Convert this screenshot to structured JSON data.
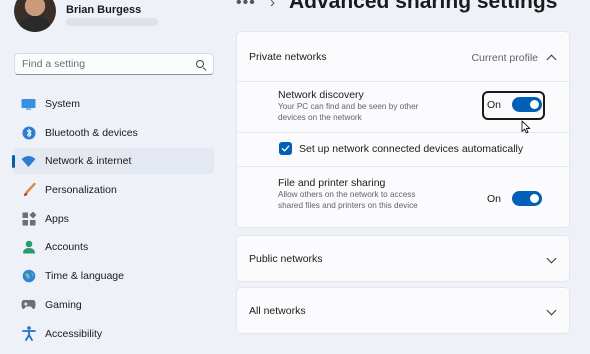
{
  "user": {
    "name": "Brian Burgess"
  },
  "search": {
    "placeholder": "Find a setting"
  },
  "sidebar": {
    "items": [
      {
        "label": "System",
        "icon": "system-icon"
      },
      {
        "label": "Bluetooth & devices",
        "icon": "bluetooth-icon"
      },
      {
        "label": "Network & internet",
        "icon": "wifi-icon",
        "active": true
      },
      {
        "label": "Personalization",
        "icon": "brush-icon"
      },
      {
        "label": "Apps",
        "icon": "apps-icon"
      },
      {
        "label": "Accounts",
        "icon": "accounts-icon"
      },
      {
        "label": "Time & language",
        "icon": "globe-icon"
      },
      {
        "label": "Gaming",
        "icon": "gamepad-icon"
      },
      {
        "label": "Accessibility",
        "icon": "accessibility-icon"
      }
    ]
  },
  "header": {
    "breadcrumb_more": "•••",
    "separator": "›",
    "title": "Advanced sharing settings"
  },
  "private": {
    "title": "Private networks",
    "status": "Current profile",
    "network_discovery": {
      "title": "Network discovery",
      "description": "Your PC can find and be seen by other devices on the network",
      "state": "On",
      "enabled": true
    },
    "auto_setup": {
      "label": "Set up network connected devices automatically",
      "checked": true
    },
    "file_sharing": {
      "title": "File and printer sharing",
      "description": "Allow others on the network to access shared files and printers on this device",
      "state": "On",
      "enabled": true
    }
  },
  "public": {
    "title": "Public networks"
  },
  "all": {
    "title": "All networks"
  },
  "colors": {
    "accent": "#005fb8",
    "background": "#eef1f8",
    "card": "#fbfbfd"
  }
}
